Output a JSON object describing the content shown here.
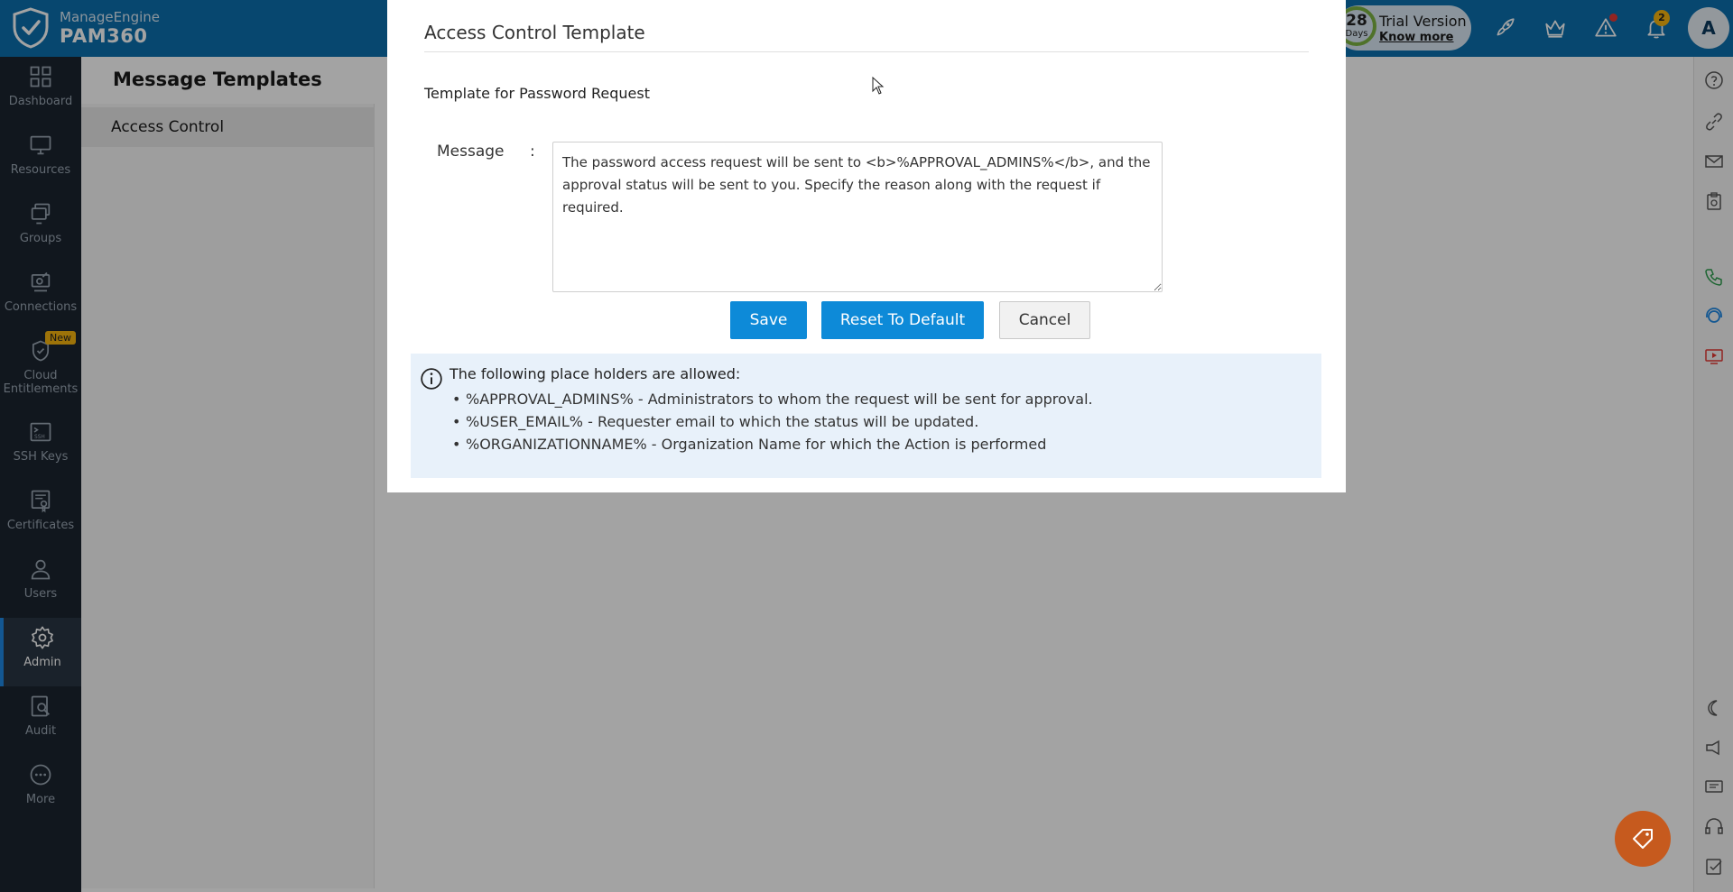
{
  "topbar": {
    "brand_company": "ManageEngine",
    "brand_product": "PAM360",
    "trial_days": "28",
    "trial_days_label": "Days",
    "trial_title": "Trial Version",
    "trial_link": "Know more",
    "notification_count": "2",
    "avatar_initial": "A",
    "icons": [
      "rocket-icon",
      "crown-icon",
      "alert-icon",
      "bell-icon"
    ]
  },
  "leftnav": {
    "items": [
      {
        "label": "Dashboard",
        "icon": "dashboard-icon"
      },
      {
        "label": "Resources",
        "icon": "monitor-icon"
      },
      {
        "label": "Groups",
        "icon": "groups-icon"
      },
      {
        "label": "Connections",
        "icon": "connections-icon"
      },
      {
        "label": "Cloud Entitlements",
        "icon": "cloud-shield-icon",
        "badge": "New"
      },
      {
        "label": "SSH Keys",
        "icon": "ssh-icon"
      },
      {
        "label": "Certificates",
        "icon": "certificate-icon"
      },
      {
        "label": "Users",
        "icon": "user-icon"
      },
      {
        "label": "Admin",
        "icon": "gear-icon",
        "active": true
      },
      {
        "label": "Audit",
        "icon": "audit-icon"
      },
      {
        "label": "More",
        "icon": "more-icon"
      }
    ]
  },
  "page": {
    "title": "Message Templates",
    "sub_nav": [
      "Access Control"
    ]
  },
  "modal": {
    "title": "Access Control Template",
    "section_title": "Template for Password Request",
    "message_label": "Message",
    "message_colon": ":",
    "message_value": "The password access request will be sent to <b>%APPROVAL_ADMINS%</b>, and the approval status will be sent to you. Specify the reason along with the request if required.",
    "buttons": {
      "save": "Save",
      "reset": "Reset To Default",
      "cancel": "Cancel"
    },
    "info": {
      "heading": "The following place holders are allowed:",
      "items": [
        "%APPROVAL_ADMINS% - Administrators to whom the request will be sent for approval.",
        "%USER_EMAIL% - Requester email to which the status will be updated.",
        "%ORGANIZATIONNAME% - Organization Name for which the Action is performed"
      ]
    }
  },
  "colors": {
    "topbar": "#0b6fae",
    "leftnav": "#1b2430",
    "primary_button": "#0d8ad8",
    "info_bg": "#e8f1fa",
    "badge": "#f6b50f"
  }
}
